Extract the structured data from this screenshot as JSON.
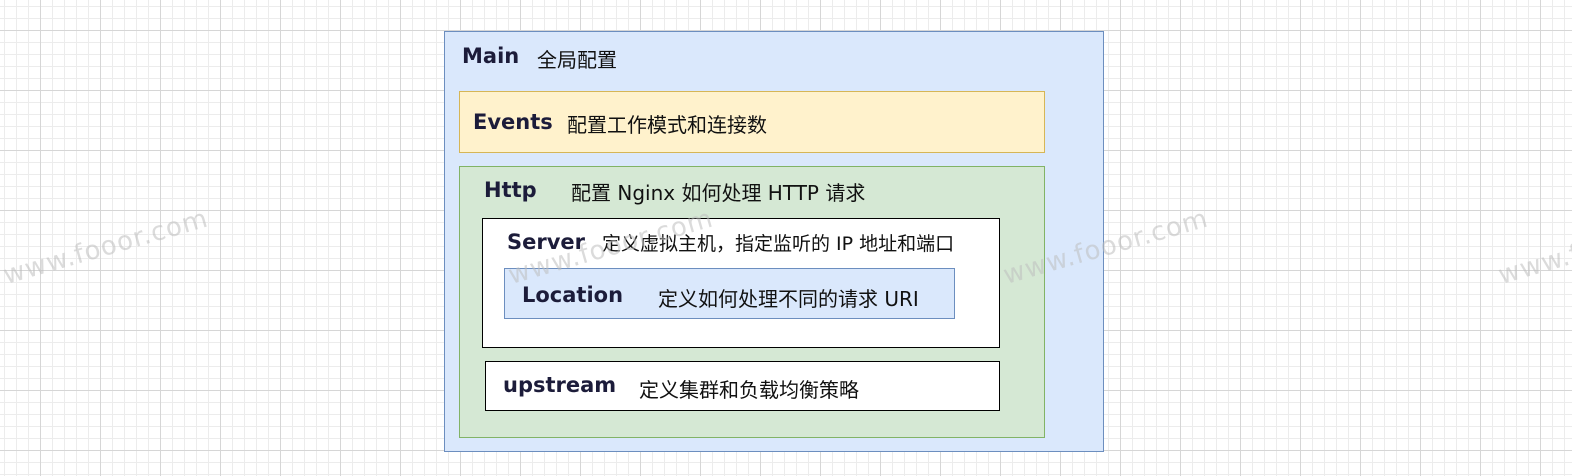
{
  "watermark": "www.fooor.com",
  "main": {
    "keyword": "Main",
    "description": "全局配置"
  },
  "events": {
    "keyword": "Events",
    "description": "配置工作模式和连接数"
  },
  "http": {
    "keyword": "Http",
    "description": "配置 Nginx 如何处理 HTTP 请求"
  },
  "server": {
    "keyword": "Server",
    "description": "定义虚拟主机，指定监听的 IP 地址和端口"
  },
  "location": {
    "keyword": "Location",
    "description": "定义如何处理不同的请求 URI"
  },
  "upstream": {
    "keyword": "upstream",
    "description": "定义集群和负载均衡策略"
  },
  "colors": {
    "main_fill": "#dae8fc",
    "main_stroke": "#6c8ebf",
    "events_fill": "#fff2cc",
    "events_stroke": "#d6b656",
    "http_fill": "#d5e8d4",
    "http_stroke": "#82b366",
    "server_fill": "#ffffff",
    "location_fill": "#dae8fc",
    "upstream_fill": "#ffffff"
  }
}
